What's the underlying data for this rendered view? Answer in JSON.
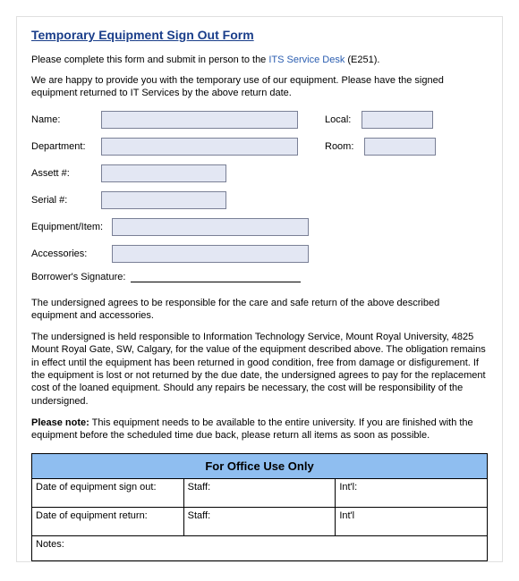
{
  "title": "Temporary Equipment Sign Out Form",
  "intro1_pre": "Please complete this form and submit in person to the ",
  "intro1_link": "ITS Service Desk",
  "intro1_post": " (E251).",
  "intro2": "We are happy to provide you with the temporary use of our equipment. Please have the signed equipment returned to IT Services by the above return date.",
  "labels": {
    "name": "Name:",
    "local": "Local:",
    "department": "Department:",
    "room": "Room:",
    "asset": "Assett #:",
    "serial": "Serial #:",
    "equipment": "Equipment/Item:",
    "accessories": "Accessories:",
    "borrower_sig": "Borrower's Signature:"
  },
  "terms1": "The undersigned agrees to be responsible for the care and safe return of the above described equipment and accessories.",
  "terms2": "The undersigned is held responsible to Information Technology Service, Mount Royal University, 4825 Mount Royal Gate, SW, Calgary, for the value of the equipment described above. The obligation remains in effect until the equipment has been returned in good condition, free from damage or disfigurement. If the equipment is lost or not returned by the due date, the undersigned agrees to pay for the replacement cost of the loaned equipment. Should any repairs be necessary, the cost will be responsibility of the undersigned.",
  "note_label": "Please note:",
  "note_text": " This equipment needs to be available to the entire university. If you are finished with the equipment before the scheduled time due back, please return all items as soon as possible.",
  "office": {
    "header": "For Office Use Only",
    "signout": "Date of equipment sign out:",
    "return": "Date of equipment return:",
    "staff": "Staff:",
    "intl": "Int'l:",
    "intl2": "Int'l",
    "notes": "Notes:"
  }
}
